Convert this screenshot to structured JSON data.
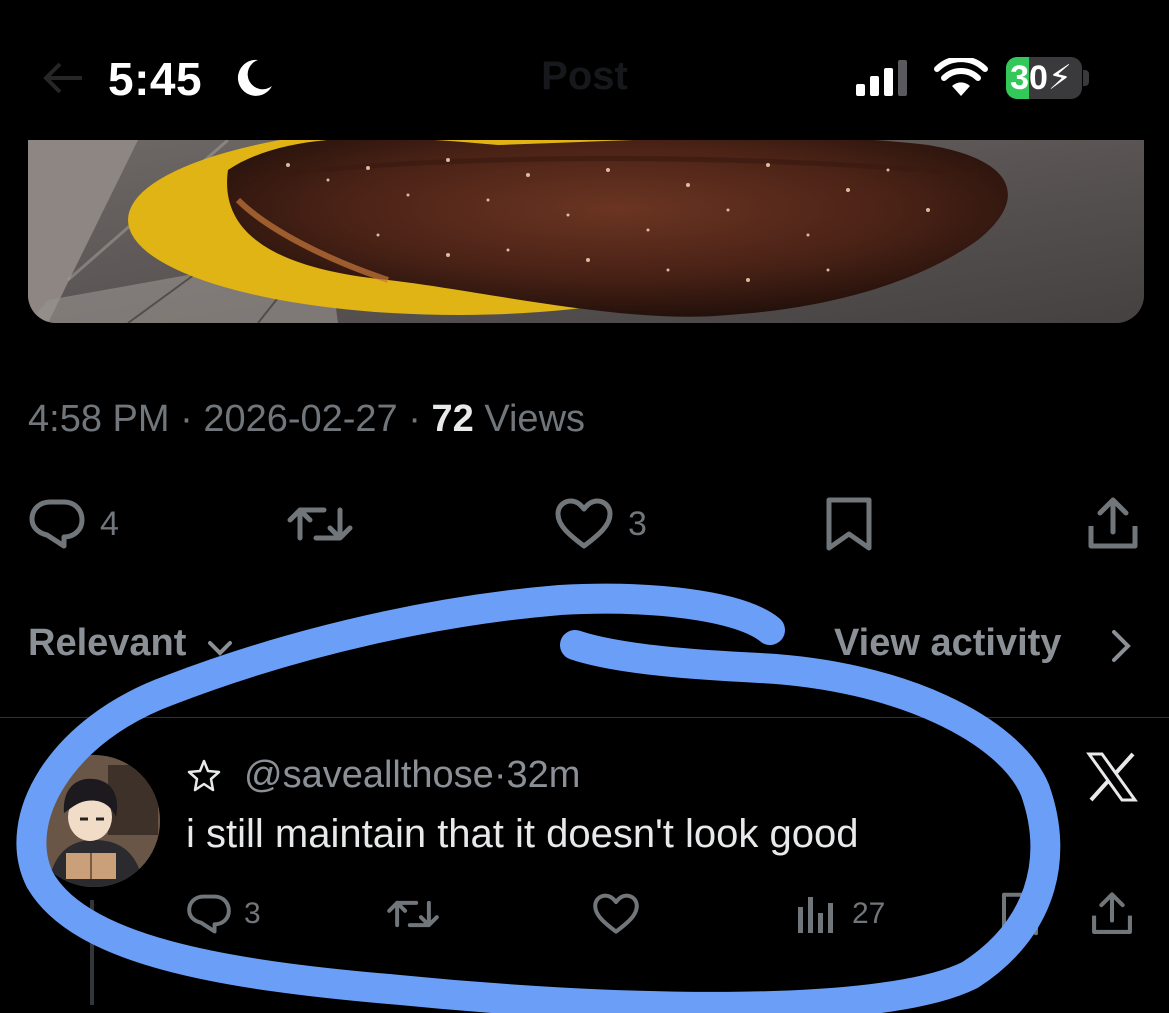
{
  "status_bar": {
    "time": "5:45",
    "battery_level": "30",
    "battery_fraction": 0.3,
    "icons": [
      "moon-icon",
      "cellular-signal-icon",
      "wifi-icon",
      "battery-charging-icon"
    ]
  },
  "nav": {
    "title": "Post"
  },
  "post": {
    "time": "4:58 PM",
    "sep": " · ",
    "date": "2026-02-27",
    "views_count": "72",
    "views_label": "Views",
    "actions": {
      "replies": "4",
      "likes": "3"
    }
  },
  "replies_bar": {
    "sort_label": "Relevant",
    "view_activity": "View activity"
  },
  "reply": {
    "handle": "@saveallthose",
    "sep": " · ",
    "age": "32m",
    "text": "i still maintain that it doesn't look good",
    "actions": {
      "replies": "3",
      "views": "27"
    }
  },
  "colors": {
    "background": "#000000",
    "text_primary": "#e7e9ea",
    "text_secondary": "#71767b",
    "battery_green": "#34c759",
    "annotation_blue": "#6b9ff7"
  }
}
